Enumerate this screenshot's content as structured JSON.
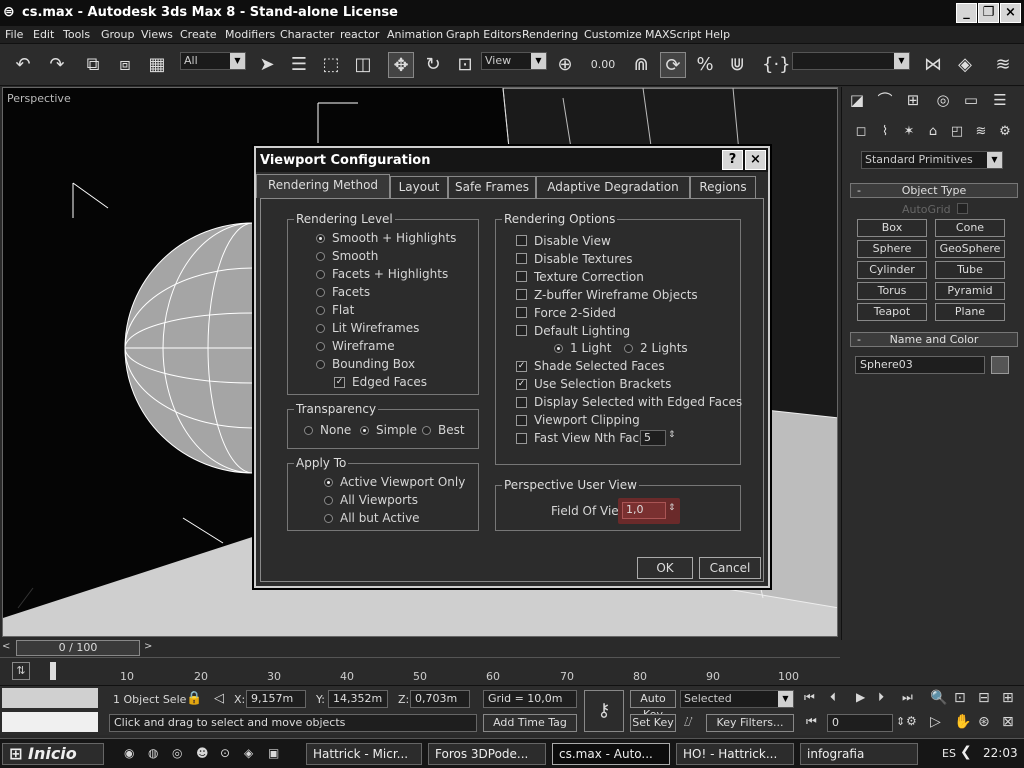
{
  "window": {
    "title": "cs.max - Autodesk 3ds Max 8  - Stand-alone License"
  },
  "menu": [
    "File",
    "Edit",
    "Tools",
    "Group",
    "Views",
    "Create",
    "Modifiers",
    "Character",
    "reactor",
    "Animation",
    "Graph Editors",
    "Rendering",
    "Customize",
    "MAXScript",
    "Help"
  ],
  "toolbar": {
    "selection_filter": "All",
    "ref_coord": "View",
    "named_selection": ""
  },
  "viewport": {
    "label": "Perspective"
  },
  "command_panel": {
    "category": "Standard Primitives",
    "object_type_header": "Object Type",
    "autogrid_label": "AutoGrid",
    "objects": [
      "Box",
      "Cone",
      "Sphere",
      "GeoSphere",
      "Cylinder",
      "Tube",
      "Torus",
      "Pyramid",
      "Teapot",
      "Plane"
    ],
    "name_color_header": "Name and Color",
    "object_name": "Sphere03",
    "collapse_glyph": "-"
  },
  "dialog": {
    "title": "Viewport Configuration",
    "help_glyph": "?",
    "close_glyph": "×",
    "tabs": [
      "Rendering Method",
      "Layout",
      "Safe Frames",
      "Adaptive Degradation",
      "Regions"
    ],
    "rendering_level": {
      "label": "Rendering Level",
      "options": [
        "Smooth + Highlights",
        "Smooth",
        "Facets + Highlights",
        "Facets",
        "Flat",
        "Lit Wireframes",
        "Wireframe",
        "Bounding Box"
      ],
      "selected": 0,
      "edged_faces": "Edged Faces"
    },
    "transparency": {
      "label": "Transparency",
      "options": [
        "None",
        "Simple",
        "Best"
      ],
      "selected": 1
    },
    "apply_to": {
      "label": "Apply To",
      "options": [
        "Active Viewport Only",
        "All Viewports",
        "All but Active"
      ],
      "selected": 0
    },
    "rendering_options": {
      "label": "Rendering Options",
      "disable_view": "Disable View",
      "disable_textures": "Disable Textures",
      "texture_correction": "Texture Correction",
      "zbuffer": "Z-buffer Wireframe Objects",
      "force2": "Force 2-Sided",
      "default_lighting": "Default Lighting",
      "light1": "1 Light",
      "light2": "2 Lights",
      "shade_selected": "Shade Selected Faces",
      "use_brackets": "Use Selection Brackets",
      "display_edged": "Display Selected with Edged Faces",
      "viewport_clipping": "Viewport Clipping",
      "fast_view": "Fast View Nth Faces:",
      "fast_view_value": "5"
    },
    "perspective": {
      "label": "Perspective User View",
      "fov_label": "Field Of View:",
      "fov_value": "1,0"
    },
    "ok": "OK",
    "cancel": "Cancel"
  },
  "timeline": {
    "frame": "0 / 100",
    "ticks": [
      "10",
      "20",
      "30",
      "40",
      "50",
      "60",
      "70",
      "80",
      "90",
      "100"
    ]
  },
  "status": {
    "selected": "1 Object Sele",
    "x_label": "X:",
    "x": "9,157m",
    "y_label": "Y:",
    "y": "14,352m",
    "z_label": "Z:",
    "z": "0,703m",
    "grid": "Grid = 10,0m",
    "auto_key": "Auto Key",
    "set_key": "Set Key",
    "key_mode": "Selected",
    "key_filters": "Key Filters...",
    "frame_field": "0",
    "prompt": "Click and drag to select and move objects",
    "add_time_tag": "Add Time Tag"
  },
  "taskbar": {
    "start": "Inicio",
    "tasks": [
      "Hattrick - Micr...",
      "Foros 3DPode...",
      "cs.max - Auto...",
      "HO! - Hattrick...",
      "infografia"
    ],
    "lang": "ES",
    "clock": "22:03"
  }
}
